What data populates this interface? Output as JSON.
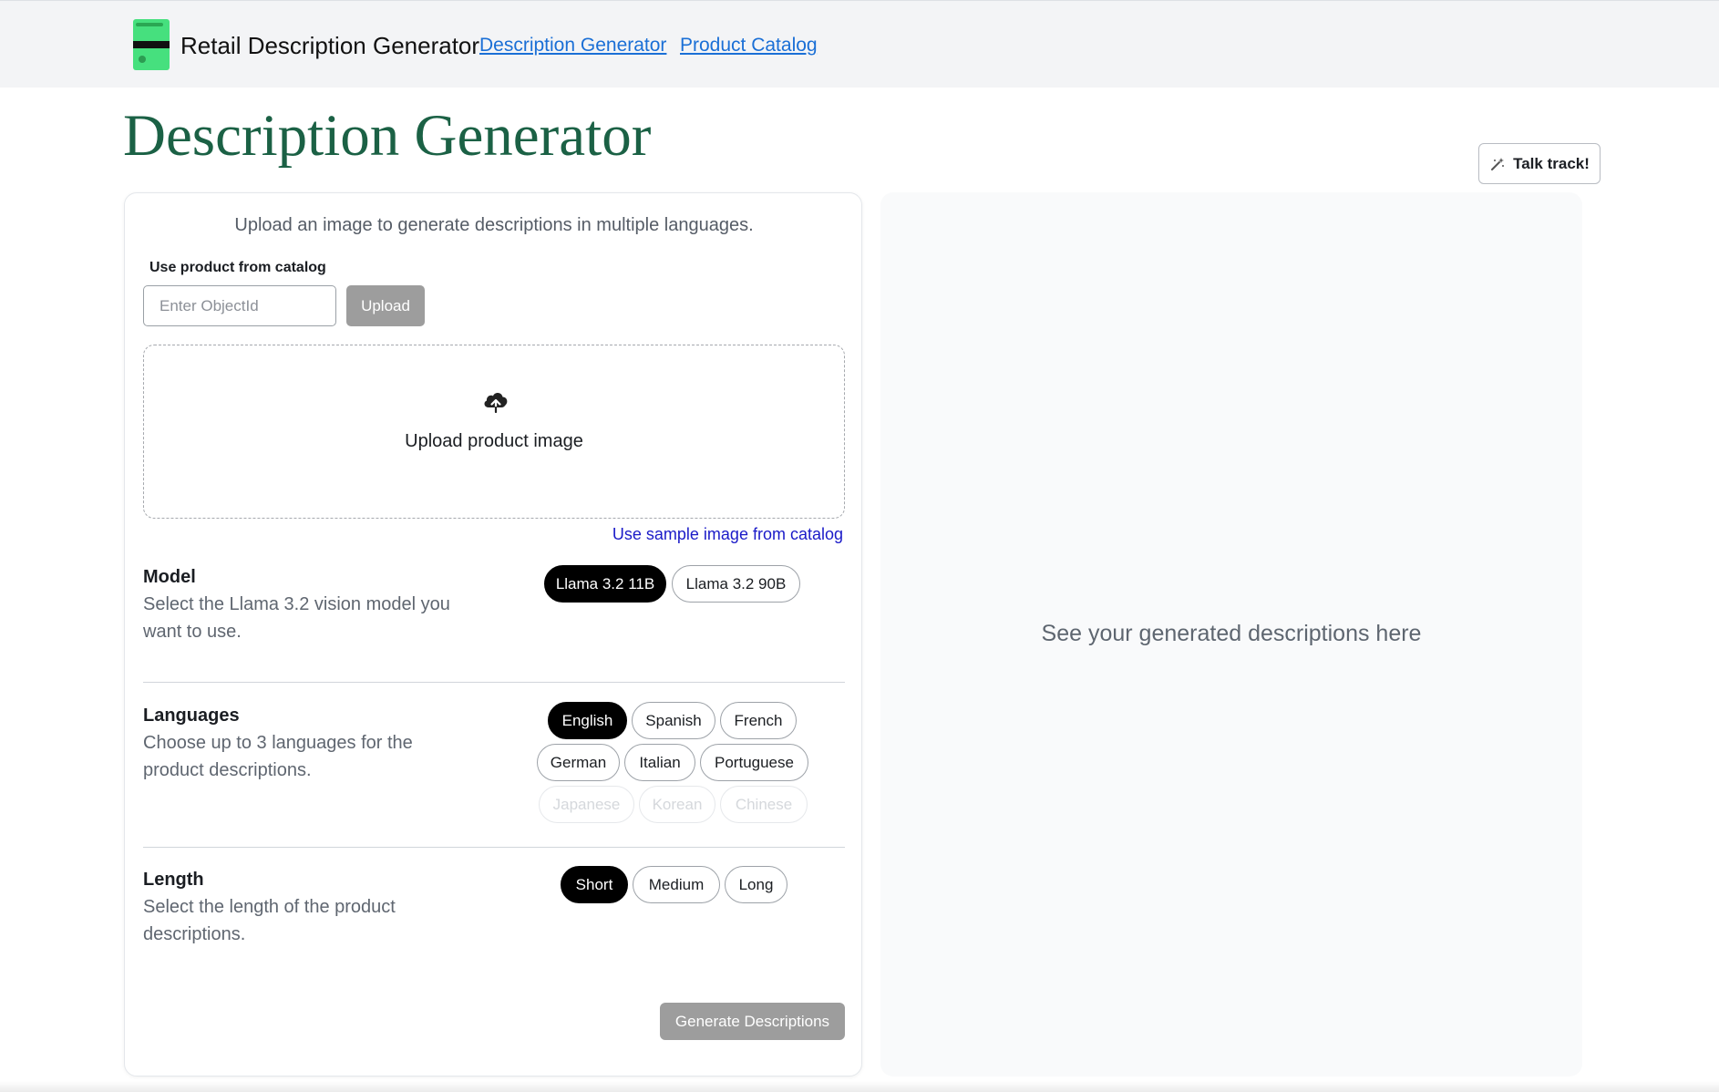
{
  "nav": {
    "brand": "Retail Description Generator",
    "links": [
      "Description Generator",
      "Product Catalog"
    ]
  },
  "page": {
    "title": "Description Generator",
    "talk_button": "Talk track!"
  },
  "form": {
    "intro": "Upload an image to generate descriptions in multiple languages.",
    "catalog_label": "Use product from catalog",
    "objectid_placeholder": "Enter ObjectId",
    "objectid_value": "",
    "upload_label": "Upload",
    "dropzone_text": "Upload product image",
    "sample_link": "Use sample image from catalog",
    "model": {
      "title": "Model",
      "description": "Select the Llama 3.2 vision model you want to use.",
      "options": [
        "Llama 3.2 11B",
        "Llama 3.2 90B"
      ],
      "selected": "Llama 3.2 11B"
    },
    "languages": {
      "title": "Languages",
      "description": "Choose up to 3 languages for the product descriptions.",
      "options": [
        "English",
        "Spanish",
        "French",
        "German",
        "Italian",
        "Portuguese",
        "Japanese",
        "Korean",
        "Chinese"
      ],
      "selected": [
        "English"
      ],
      "disabled": [
        "Japanese",
        "Korean",
        "Chinese"
      ]
    },
    "length": {
      "title": "Length",
      "description": "Select the length of the product descriptions.",
      "options": [
        "Short",
        "Medium",
        "Long"
      ],
      "selected": "Short"
    },
    "generate_label": "Generate Descriptions"
  },
  "output": {
    "placeholder": "See your generated descriptions here"
  },
  "colors": {
    "title_green": "#1b6145",
    "link_blue": "#1a6fd6",
    "sample_link_blue": "#1a1ac8",
    "disabled_button_gray": "#9d9d9d",
    "active_pill": "#000000",
    "logo_green": "#46e07e"
  },
  "icons": {
    "logo": "product-card-logo",
    "talk_track": "magic-wand-icon",
    "dropzone": "cloud-upload-icon"
  }
}
